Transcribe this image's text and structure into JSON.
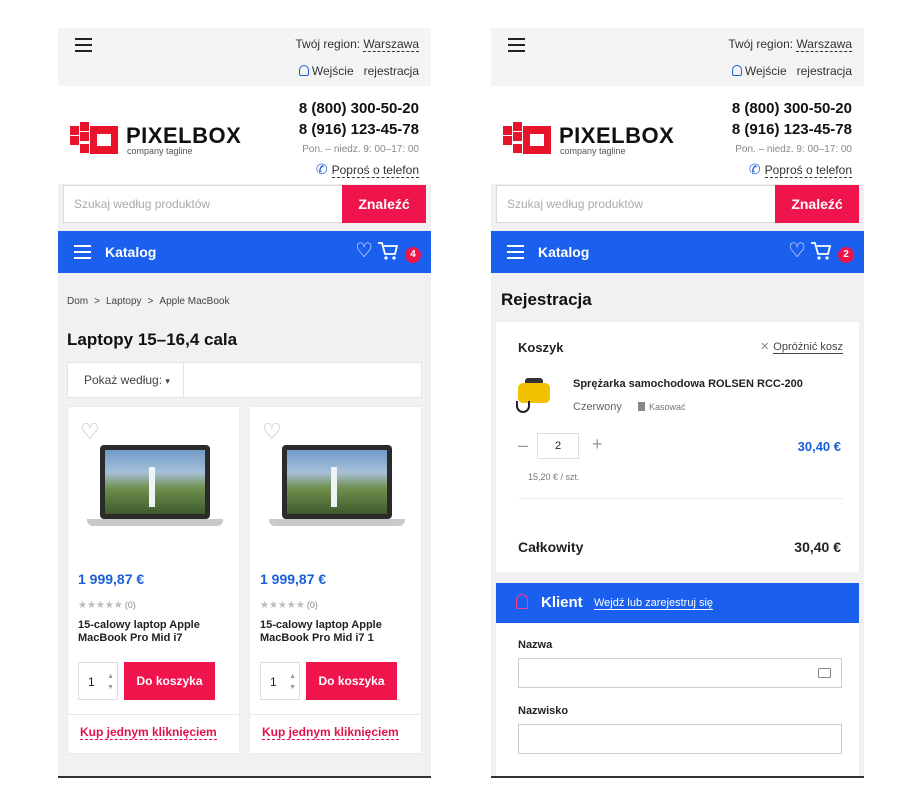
{
  "common": {
    "region_label": "Twój region:",
    "region_city": "Warszawa",
    "login": "Wejście",
    "register": "rejestracja",
    "phone1": "8 (800) 300-50-20",
    "phone2": "8 (916) 123-45-78",
    "hours": "Pon. – niedz. 9: 00–17: 00",
    "callback": "Poproś o telefon",
    "logo_name": "PIXELBOX",
    "logo_tagline": "company tagline",
    "search_placeholder": "Szukaj według produktów",
    "search_button": "Znaleźć",
    "catalog": "Katalog",
    "colors": {
      "brand_blue": "#1a5fee",
      "accent_red": "#f0144c",
      "price_blue": "#1a5fd8"
    }
  },
  "screen1": {
    "cart_count": "4",
    "breadcrumbs": [
      "Dom",
      "Laptopy",
      "Apple MacBook"
    ],
    "breadcrumb_sep": ">",
    "title": "Laptopy 15–16,4 cala",
    "sort_label": "Pokaż według:",
    "products": [
      {
        "price": "1 999,87 €",
        "reviews": "(0)",
        "name": "15-calowy laptop Apple MacBook Pro Mid i7",
        "qty": "1",
        "to_cart": "Do koszyka",
        "one_click": "Kup jednym kliknięciem"
      },
      {
        "price": "1 999,87 €",
        "reviews": "(0)",
        "name": "15-calowy laptop Apple MacBook Pro Mid i7 1",
        "qty": "1",
        "to_cart": "Do koszyka",
        "one_click": "Kup jednym kliknięciem"
      }
    ]
  },
  "screen2": {
    "cart_count": "2",
    "title": "Rejestracja",
    "basket": {
      "title": "Koszyk",
      "clear": "Opróżnić kosz",
      "item_name": "Sprężarka samochodowa ROLSEN RCC-200",
      "item_color": "Czerwony",
      "delete": "Kasować",
      "qty": "2",
      "item_price": "30,40 €",
      "unit_price": "15,20 € / szt.",
      "total_label": "Całkowity",
      "total_value": "30,40 €"
    },
    "client": {
      "label": "Klient",
      "link": "Wejdź lub zarejestruj się"
    },
    "form": {
      "name_label": "Nazwa",
      "surname_label": "Nazwisko"
    }
  }
}
